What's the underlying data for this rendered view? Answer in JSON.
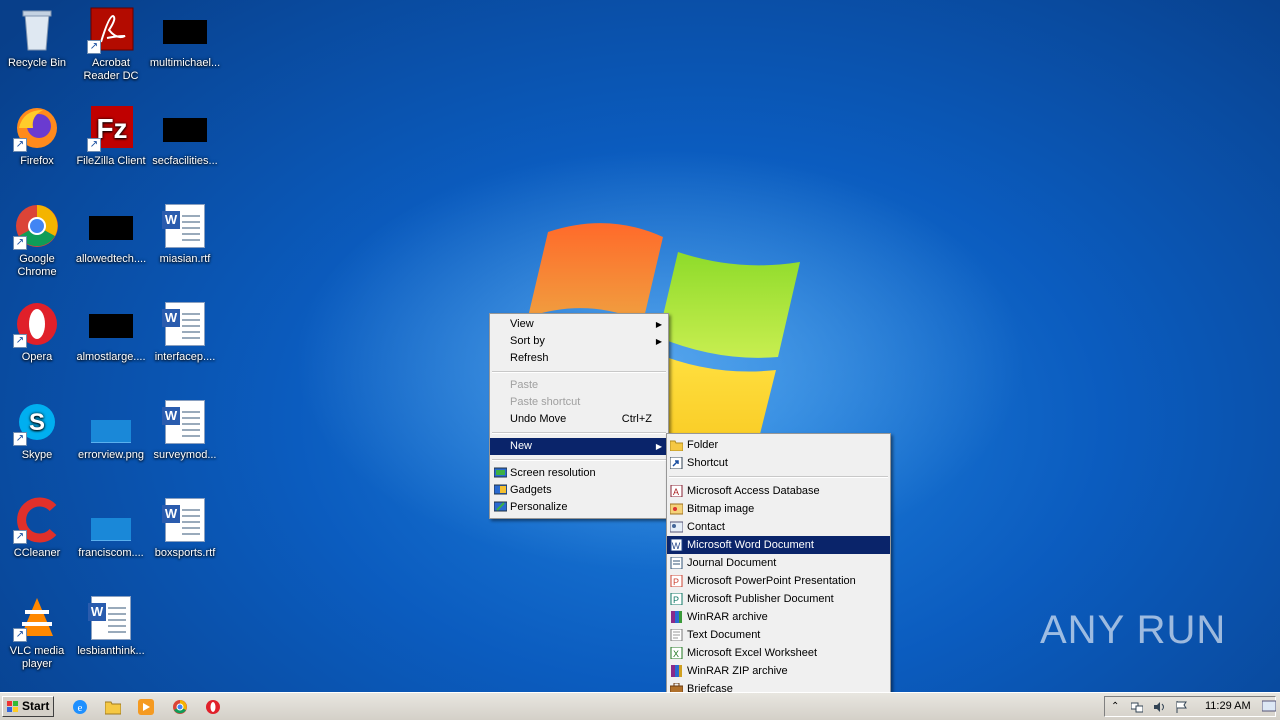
{
  "desktop_icons": [
    {
      "label": "Recycle Bin",
      "icon": "recycle-bin-icon"
    },
    {
      "label": "Acrobat Reader DC",
      "icon": "acrobat-icon"
    },
    {
      "label": "multimichael...",
      "icon": "redacted-file-icon"
    },
    {
      "label": "Firefox",
      "icon": "firefox-icon"
    },
    {
      "label": "FileZilla Client",
      "icon": "filezilla-icon"
    },
    {
      "label": "secfacilities...",
      "icon": "redacted-file-icon"
    },
    {
      "label": "Google Chrome",
      "icon": "chrome-icon"
    },
    {
      "label": "allowedtech....",
      "icon": "redacted-file-icon"
    },
    {
      "label": "miasian.rtf",
      "icon": "word-doc-icon"
    },
    {
      "label": "Opera",
      "icon": "opera-icon"
    },
    {
      "label": "almostlarge....",
      "icon": "redacted-file-icon"
    },
    {
      "label": "interfacep....",
      "icon": "word-doc-icon"
    },
    {
      "label": "Skype",
      "icon": "skype-icon"
    },
    {
      "label": "errorview.png",
      "icon": "image-thumb-icon"
    },
    {
      "label": "surveymod...",
      "icon": "word-doc-icon"
    },
    {
      "label": "CCleaner",
      "icon": "ccleaner-icon"
    },
    {
      "label": "franciscom....",
      "icon": "image-thumb-icon"
    },
    {
      "label": "boxsports.rtf",
      "icon": "word-doc-icon"
    },
    {
      "label": "VLC media player",
      "icon": "vlc-icon"
    },
    {
      "label": "lesbianthink...",
      "icon": "word-doc-icon"
    }
  ],
  "context_menu": {
    "view": "View",
    "sort_by": "Sort by",
    "refresh": "Refresh",
    "paste": "Paste",
    "paste_shortcut": "Paste shortcut",
    "undo_move": "Undo Move",
    "undo_shortcut": "Ctrl+Z",
    "new": "New",
    "screen_resolution": "Screen resolution",
    "gadgets": "Gadgets",
    "personalize": "Personalize"
  },
  "new_submenu": {
    "folder": "Folder",
    "shortcut": "Shortcut",
    "access": "Microsoft Access Database",
    "bitmap": "Bitmap image",
    "contact": "Contact",
    "word": "Microsoft Word Document",
    "journal": "Journal Document",
    "powerpoint": "Microsoft PowerPoint Presentation",
    "publisher": "Microsoft Publisher Document",
    "winrar": "WinRAR archive",
    "text": "Text Document",
    "excel": "Microsoft Excel Worksheet",
    "winrar_zip": "WinRAR ZIP archive",
    "briefcase": "Briefcase"
  },
  "taskbar": {
    "start": "Start",
    "clock": "11:29 AM",
    "quick_launch": [
      "ie-icon",
      "explorer-icon",
      "media-player-icon",
      "chrome-icon",
      "opera-icon"
    ]
  },
  "watermark": "ANY RUN",
  "colors": {
    "menu_highlight": "#0a246a",
    "desktop_blue": "#0b5cbf"
  }
}
